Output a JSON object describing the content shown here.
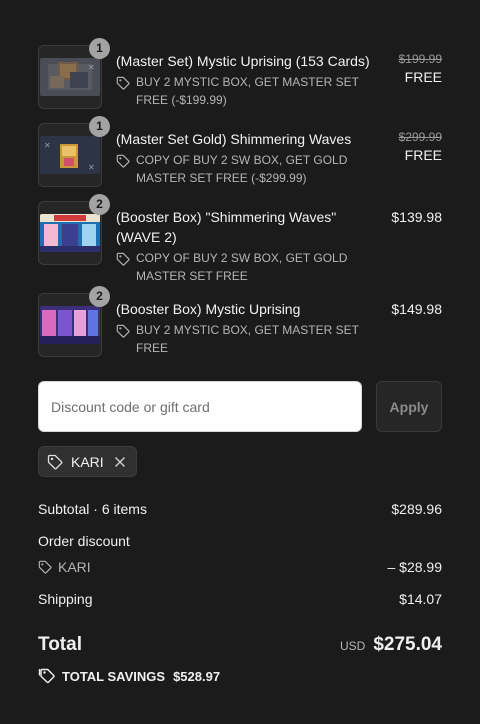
{
  "items": [
    {
      "qty": "1",
      "name": "(Master Set) Mystic Uprising (153 Cards)",
      "discount": "BUY 2 MYSTIC BOX, GET MASTER SET FREE (-$199.99)",
      "old_price": "$199.99",
      "price": "FREE",
      "thumb": "box-stack"
    },
    {
      "qty": "1",
      "name": "(Master Set Gold) Shimmering Waves",
      "discount": "COPY OF BUY 2 SW BOX, GET GOLD MASTER SET FREE (-$299.99)",
      "old_price": "$299.99",
      "price": "FREE",
      "thumb": "gold-box"
    },
    {
      "qty": "2",
      "name": "(Booster Box) \"Shimmering Waves\" (WAVE 2)",
      "discount": "COPY OF BUY 2 SW BOX, GET GOLD MASTER SET FREE",
      "old_price": "",
      "price": "$139.98",
      "thumb": "waves-booster"
    },
    {
      "qty": "2",
      "name": "(Booster Box) Mystic Uprising",
      "discount": "BUY 2 MYSTIC BOX, GET MASTER SET FREE",
      "old_price": "",
      "price": "$149.98",
      "thumb": "mystic-booster"
    }
  ],
  "discount_form": {
    "placeholder": "Discount code or gift card",
    "value": "",
    "apply_label": "Apply"
  },
  "applied_code": {
    "label": "KARI",
    "icon": "tag-icon",
    "remove_icon": "close-icon"
  },
  "summary": {
    "subtotal_label": "Subtotal · 6 items",
    "subtotal_value": "$289.96",
    "order_discount_label": "Order discount",
    "discount_code": "KARI",
    "discount_value": "– $28.99",
    "shipping_label": "Shipping",
    "shipping_value": "$14.07",
    "total_label": "Total",
    "currency": "USD",
    "total_value": "$275.04",
    "savings_label": "TOTAL SAVINGS",
    "savings_value": "$528.97"
  },
  "colors": {
    "background": "#1b1b1b",
    "text": "#f0f0f0",
    "muted": "#b5b5b5",
    "badge": "#a3a3a3"
  }
}
